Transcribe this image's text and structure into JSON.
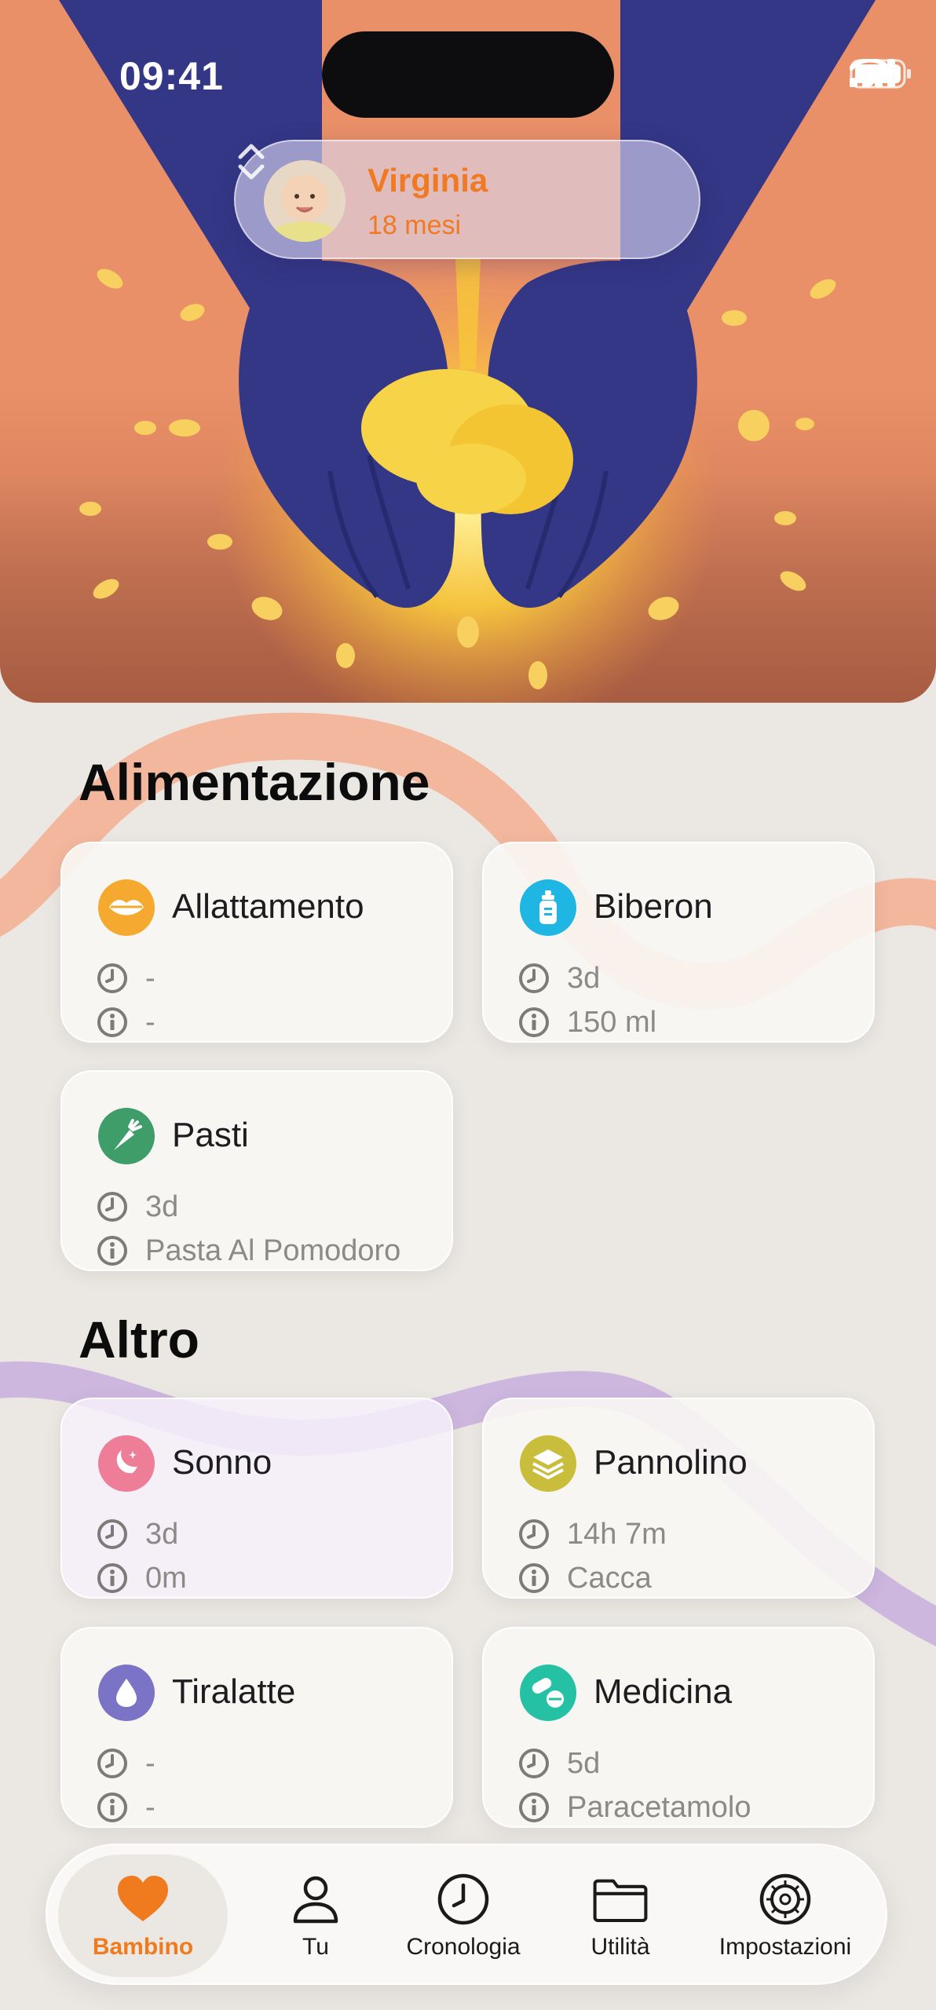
{
  "status_bar": {
    "time": "09:41"
  },
  "profile": {
    "name": "Virginia",
    "age": "18 mesi"
  },
  "sections": {
    "feeding": {
      "title": "Alimentazione",
      "cards": [
        {
          "title": "Allattamento",
          "time": "-",
          "info": "-",
          "icon": "lips-icon",
          "color": "#f6a92f"
        },
        {
          "title": "Biberon",
          "time": "3d",
          "info": "150 ml",
          "icon": "baby-bottle-icon",
          "color": "#1fb6e3"
        },
        {
          "title": "Pasti",
          "time": "3d",
          "info": "Pasta Al Pomodoro",
          "icon": "carrot-icon",
          "color": "#3f9d69"
        }
      ]
    },
    "other": {
      "title": "Altro",
      "cards": [
        {
          "title": "Sonno",
          "time": "3d",
          "info": "0m",
          "icon": "moon-icon",
          "color": "#ee7e97"
        },
        {
          "title": "Pannolino",
          "time": "14h 7m",
          "info": "Cacca",
          "icon": "diaper-icon",
          "color": "#c9bd3c"
        },
        {
          "title": "Tiralatte",
          "time": "-",
          "info": "-",
          "icon": "drop-icon",
          "color": "#7a73c6"
        },
        {
          "title": "Medicina",
          "time": "5d",
          "info": "Paracetamolo",
          "icon": "pills-icon",
          "color": "#25c1a5"
        }
      ]
    }
  },
  "tabs": [
    {
      "label": "Bambino",
      "icon": "heart-icon",
      "active": true
    },
    {
      "label": "Tu",
      "icon": "person-icon",
      "active": false
    },
    {
      "label": "Cronologia",
      "icon": "clock-icon",
      "active": false
    },
    {
      "label": "Utilità",
      "icon": "folder-icon",
      "active": false
    },
    {
      "label": "Impostazioni",
      "icon": "gear-icon",
      "active": false
    }
  ],
  "colors": {
    "accent": "#f07a1e",
    "hero_background": "#ea9068",
    "hands": "#343786",
    "baby": "#f7d347",
    "background": "#ebe8e4"
  }
}
